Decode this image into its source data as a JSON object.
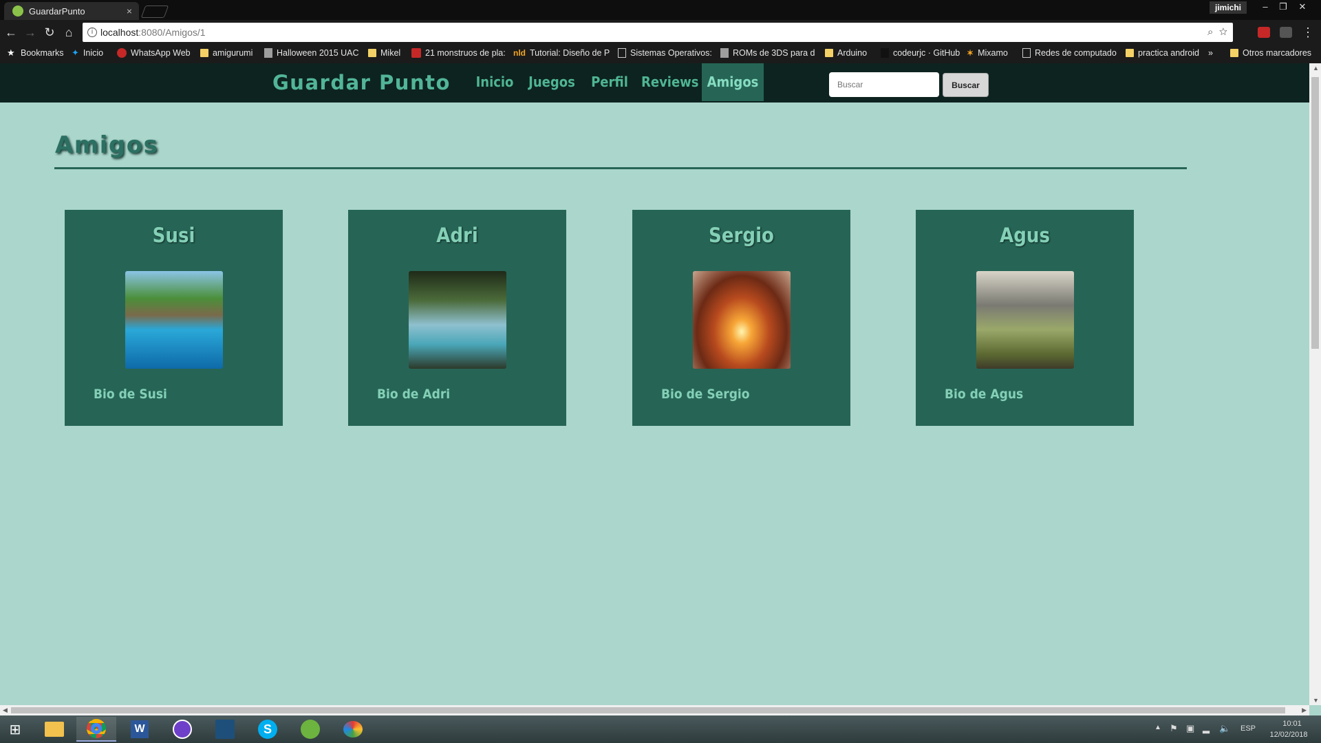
{
  "browser": {
    "tab_title": "GuardarPunto",
    "close_tab_glyph": "×",
    "user_name": "jimichi",
    "url_host": "localhost",
    "url_path": ":8080/Amigos/1",
    "window_controls": {
      "minimize": "–",
      "restore": "❐",
      "close": "✕"
    }
  },
  "bookmarks": [
    {
      "label": "Bookmarks",
      "icon": "star-icon"
    },
    {
      "label": "Inicio",
      "icon": "twitter-icon"
    },
    {
      "label": "WhatsApp Web",
      "icon": "whatsapp-icon"
    },
    {
      "label": "amigurumi",
      "icon": "folder-icon"
    },
    {
      "label": "Halloween 2015 UAC",
      "icon": "page-icon"
    },
    {
      "label": "Mikel",
      "icon": "folder-icon"
    },
    {
      "label": "21 monstruos de pla:",
      "icon": "red-site-icon"
    },
    {
      "label": "Tutorial: Diseño de P",
      "icon": "nld-icon"
    },
    {
      "label": "Sistemas Operativos:",
      "icon": "page-icon"
    },
    {
      "label": "ROMs de 3DS para d",
      "icon": "page-icon"
    },
    {
      "label": "Arduino",
      "icon": "folder-icon"
    },
    {
      "label": "codeurjc · GitHub",
      "icon": "github-icon"
    },
    {
      "label": "Mixamo",
      "icon": "mixamo-icon"
    },
    {
      "label": "Redes de computado",
      "icon": "page-icon"
    },
    {
      "label": "practica android",
      "icon": "folder-icon"
    }
  ],
  "bookmarks_more": "»",
  "bookmarks_other": "Otros marcadores",
  "site": {
    "brand": "Guardar Punto",
    "nav": [
      {
        "label": "Inicio",
        "active": false
      },
      {
        "label": "Juegos",
        "active": false
      },
      {
        "label": "Perfil",
        "active": false
      },
      {
        "label": "Reviews",
        "active": false
      },
      {
        "label": "Amigos",
        "active": true
      }
    ],
    "search_placeholder": "Buscar",
    "search_button": "Buscar"
  },
  "page": {
    "title": "Amigos",
    "friends": [
      {
        "name": "Susi",
        "bio": "Bio de Susi",
        "photo": "waterfall-pool-photo"
      },
      {
        "name": "Adri",
        "bio": "Bio de Adri",
        "photo": "tropical-beach-tree-photo"
      },
      {
        "name": "Sergio",
        "bio": "Bio de Sergio",
        "photo": "sunset-rock-arch-photo"
      },
      {
        "name": "Agus",
        "bio": "Bio de Agus",
        "photo": "country-road-clouds-photo"
      }
    ]
  },
  "taskbar": {
    "apps": [
      "windows-start-icon",
      "file-explorer-icon",
      "chrome-icon",
      "word-icon",
      "github-desktop-icon",
      "mysql-workbench-icon",
      "skype-icon",
      "spring-tool-suite-icon",
      "paint-icon"
    ],
    "language": "ESP",
    "time": "10:01",
    "date": "12/02/2018"
  },
  "colors": {
    "page_bg": "#abd6cb",
    "nav_bg": "#0d231f",
    "accent": "#266556",
    "accent_text": "#84d0b6"
  }
}
